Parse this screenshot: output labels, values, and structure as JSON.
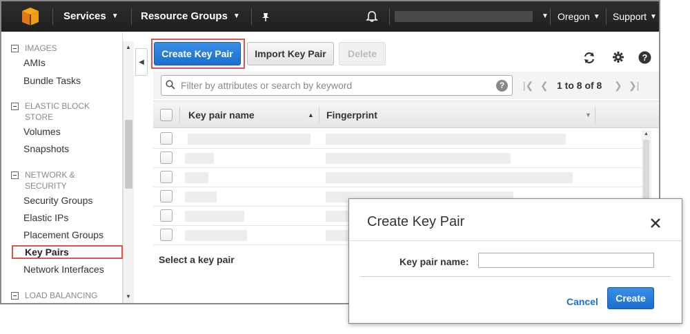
{
  "topnav": {
    "services": "Services",
    "resource_groups": "Resource Groups",
    "region": "Oregon",
    "support": "Support"
  },
  "sidebar": {
    "sections": [
      {
        "label": "IMAGES"
      },
      {
        "label": "ELASTIC BLOCK STORE"
      },
      {
        "label": "NETWORK & SECURITY"
      },
      {
        "label": "LOAD BALANCING"
      }
    ],
    "items": [
      "AMIs",
      "Bundle Tasks",
      "Volumes",
      "Snapshots",
      "Security Groups",
      "Elastic IPs",
      "Placement Groups",
      "Key Pairs",
      "Network Interfaces"
    ]
  },
  "toolbar": {
    "create_label": "Create Key Pair",
    "import_label": "Import Key Pair",
    "delete_label": "Delete"
  },
  "filter": {
    "placeholder": "Filter by attributes or search by keyword",
    "pager_text": "1 to 8 of 8"
  },
  "table": {
    "col_name": "Key pair name",
    "col_fingerprint": "Fingerprint",
    "footer": "Select a key pair"
  },
  "dialog": {
    "title": "Create Key Pair",
    "field_label": "Key pair name:",
    "cancel_label": "Cancel",
    "create_label": "Create"
  },
  "colors": {
    "primary": "#1a6fd0",
    "highlight": "#d9534f",
    "nav_bg": "#232f3e"
  }
}
